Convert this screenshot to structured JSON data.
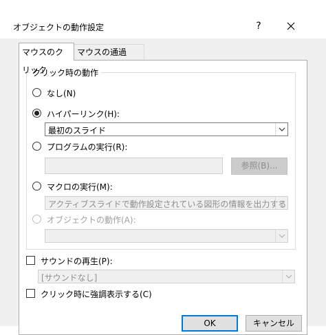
{
  "dialog": {
    "title": "オブジェクトの動作設定",
    "help_label": "?"
  },
  "tabs": [
    {
      "label": "マウスのクリック"
    },
    {
      "label": "マウスの通過"
    }
  ],
  "group": {
    "legend": "クリック時の動作",
    "options": {
      "none": "なし(N)",
      "hyperlink": "ハイパーリンク(H):",
      "program": "プログラムの実行(R):",
      "macro": "マクロの実行(M):",
      "object_action": "オブジェクトの動作(A):"
    },
    "hyperlink_value": "最初のスライド",
    "program_path": "",
    "browse_label": "参照(B)...",
    "macro_value": "アクティブスライドで動作設定されている図形の情報を出力する",
    "object_action_value": ""
  },
  "sound": {
    "label": "サウンドの再生(P):",
    "value": "[サウンドなし]"
  },
  "highlight": {
    "label": "クリック時に強調表示する(C)"
  },
  "footer": {
    "ok_label": "OK",
    "cancel_label": "キャンセル"
  }
}
